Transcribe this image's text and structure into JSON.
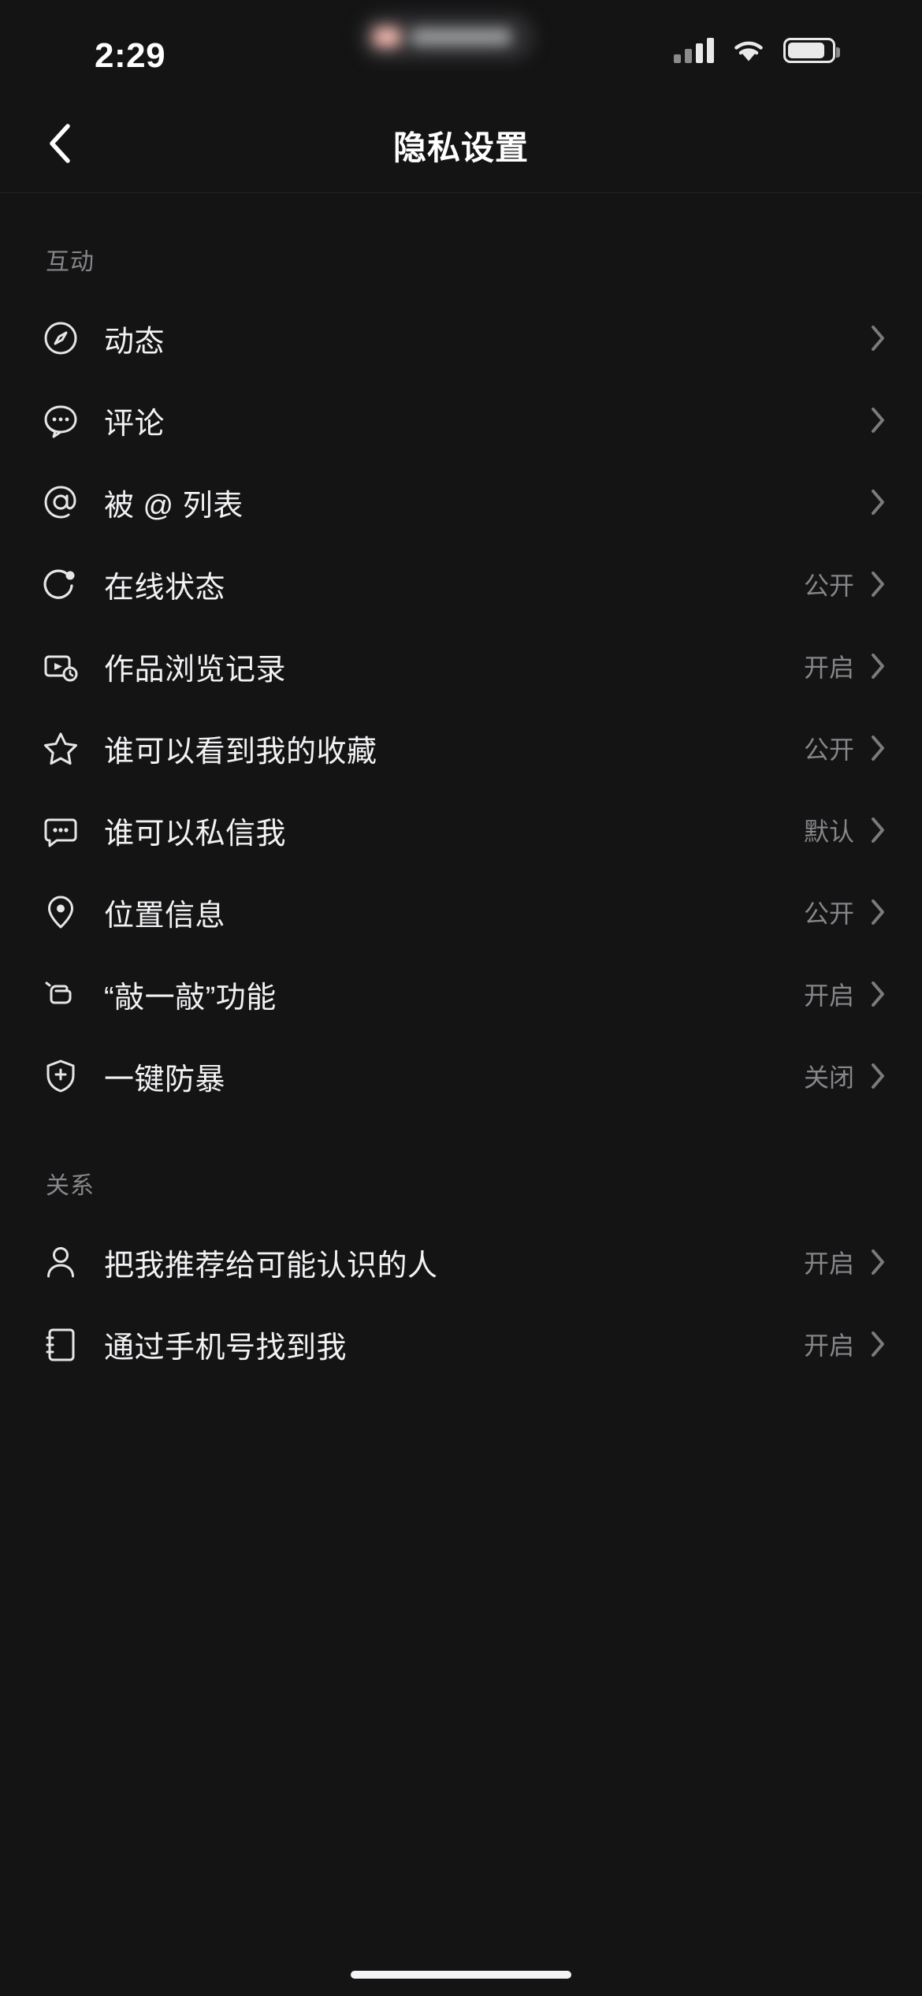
{
  "status_bar": {
    "time": "2:29",
    "signal_icon": "cellular-signal-icon",
    "wifi_icon": "wifi-icon",
    "battery_icon": "battery-icon"
  },
  "nav": {
    "back_icon": "back-chevron-icon",
    "title": "隐私设置"
  },
  "sections": [
    {
      "title": "互动",
      "rows": [
        {
          "icon": "compass-icon",
          "label": "动态",
          "value": ""
        },
        {
          "icon": "comment-icon",
          "label": "评论",
          "value": ""
        },
        {
          "icon": "at-sign-icon",
          "label": "被 @ 列表",
          "value": ""
        },
        {
          "icon": "online-status-icon",
          "label": "在线状态",
          "value": "公开"
        },
        {
          "icon": "video-history-icon",
          "label": "作品浏览记录",
          "value": "开启"
        },
        {
          "icon": "star-icon",
          "label": "谁可以看到我的收藏",
          "value": "公开"
        },
        {
          "icon": "message-icon",
          "label": "谁可以私信我",
          "value": "默认"
        },
        {
          "icon": "location-pin-icon",
          "label": "位置信息",
          "value": "公开"
        },
        {
          "icon": "knock-icon",
          "label": "“敲一敲”功能",
          "value": "开启"
        },
        {
          "icon": "shield-plus-icon",
          "label": "一键防暴",
          "value": "关闭"
        }
      ]
    },
    {
      "title": "关系",
      "rows": [
        {
          "icon": "person-icon",
          "label": "把我推荐给可能认识的人",
          "value": "开启"
        },
        {
          "icon": "phone-book-icon",
          "label": "通过手机号找到我",
          "value": "开启"
        }
      ]
    }
  ],
  "chevron_icon": "chevron-right-icon",
  "home_indicator": "home-indicator"
}
